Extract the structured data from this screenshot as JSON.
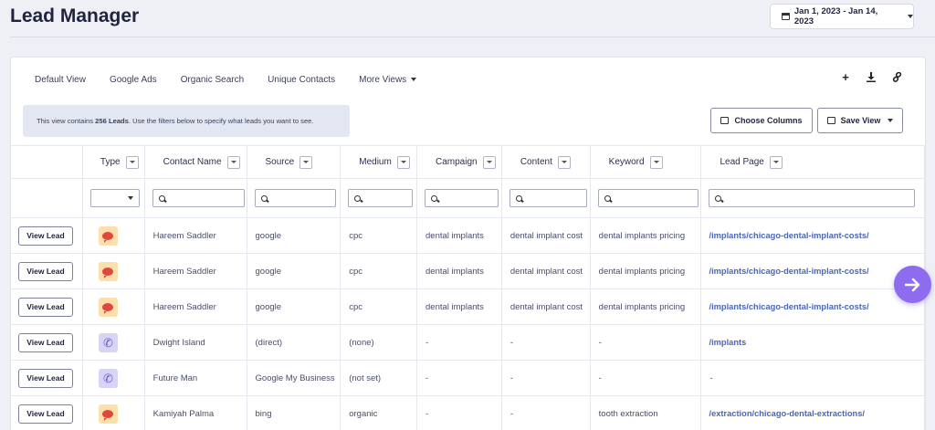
{
  "header": {
    "title": "Lead Manager",
    "date_range": "Jan 1, 2023 - Jan 14, 2023"
  },
  "tabs": [
    {
      "label": "Default View"
    },
    {
      "label": "Google Ads"
    },
    {
      "label": "Organic Search"
    },
    {
      "label": "Unique Contacts"
    },
    {
      "label": "More Views"
    }
  ],
  "toolbar_icons": [
    "plus-icon",
    "download-icon",
    "link-icon"
  ],
  "info": {
    "prefix": "This view contains ",
    "count": "256 Leads",
    "suffix": ". Use the filters below to specify what leads you want to see."
  },
  "buttons": {
    "choose_columns": "Choose Columns",
    "save_view": "Save View",
    "view_lead": "View Lead"
  },
  "columns": [
    "Type",
    "Contact Name",
    "Source",
    "Medium",
    "Campaign",
    "Content",
    "Keyword",
    "Lead Page"
  ],
  "rows": [
    {
      "type": "chat",
      "name": "Hareem Saddler",
      "source": "google",
      "medium": "cpc",
      "campaign": "dental implants",
      "content": "dental implant cost",
      "keyword": "dental implants pricing",
      "page": "/implants/chicago-dental-implant-costs/"
    },
    {
      "type": "chat",
      "name": "Hareem Saddler",
      "source": "google",
      "medium": "cpc",
      "campaign": "dental implants",
      "content": "dental implant cost",
      "keyword": "dental implants pricing",
      "page": "/implants/chicago-dental-implant-costs/"
    },
    {
      "type": "chat",
      "name": "Hareem Saddler",
      "source": "google",
      "medium": "cpc",
      "campaign": "dental implants",
      "content": "dental implant cost",
      "keyword": "dental implants pricing",
      "page": "/implants/chicago-dental-implant-costs/"
    },
    {
      "type": "phone",
      "name": "Dwight Island",
      "source": "(direct)",
      "medium": "(none)",
      "campaign": "-",
      "content": "-",
      "keyword": "-",
      "page": "/implants"
    },
    {
      "type": "phone",
      "name": "Future Man",
      "source": "Google My Business",
      "medium": "(not set)",
      "campaign": "-",
      "content": "-",
      "keyword": "-",
      "page": "-"
    },
    {
      "type": "chat",
      "name": "Kamiyah Palma",
      "source": "bing",
      "medium": "organic",
      "campaign": "-",
      "content": "-",
      "keyword": "tooth extraction",
      "page": "/extraction/chicago-dental-extractions/"
    }
  ],
  "colors": {
    "accent": "#8e6cf0",
    "link": "#4a66b8",
    "chat_icon_bg": "#fbe0ae",
    "phone_icon_bg": "#d7d4f5"
  }
}
